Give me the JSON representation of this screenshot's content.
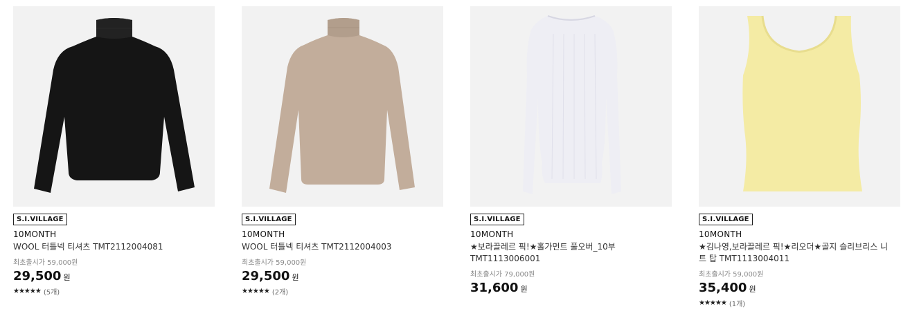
{
  "products": [
    {
      "badge": "S.I.VILLAGE",
      "brand": "10MONTH",
      "name": "WOOL 터틀넥 티셔츠 TMT2112004081",
      "orig_price": "최초출시가 59,000원",
      "price": "29,500",
      "currency": "원",
      "stars": "★★★★★",
      "review_count": "(5개)",
      "color": "#151515",
      "icon": "black-turtleneck-image"
    },
    {
      "badge": "S.I.VILLAGE",
      "brand": "10MONTH",
      "name": "WOOL 터틀넥 티셔츠 TMT2112004003",
      "orig_price": "최초출시가 59,000원",
      "price": "29,500",
      "currency": "원",
      "stars": "★★★★★",
      "review_count": "(2개)",
      "color": "#c2ad9b",
      "icon": "beige-turtleneck-image"
    },
    {
      "badge": "S.I.VILLAGE",
      "brand": "10MONTH",
      "name": "★보라끌레르 픽!★홀가먼트 풀오버_10부 TMT1113006001",
      "orig_price": "최초출시가 79,000원",
      "price": "31,600",
      "currency": "원",
      "stars": "",
      "review_count": "",
      "color": "#eeeef4",
      "icon": "white-ribbed-pullover-image"
    },
    {
      "badge": "S.I.VILLAGE",
      "brand": "10MONTH",
      "name": "★김나영,보라끌레르 픽!★리오더★골지 슬리브리스 니트 탑 TMT1113004011",
      "orig_price": "최초출시가 59,000원",
      "price": "35,400",
      "currency": "원",
      "stars": "★★★★★",
      "review_count": "(1개)",
      "color": "#f4eba4",
      "icon": "yellow-sleeveless-knit-image"
    }
  ]
}
